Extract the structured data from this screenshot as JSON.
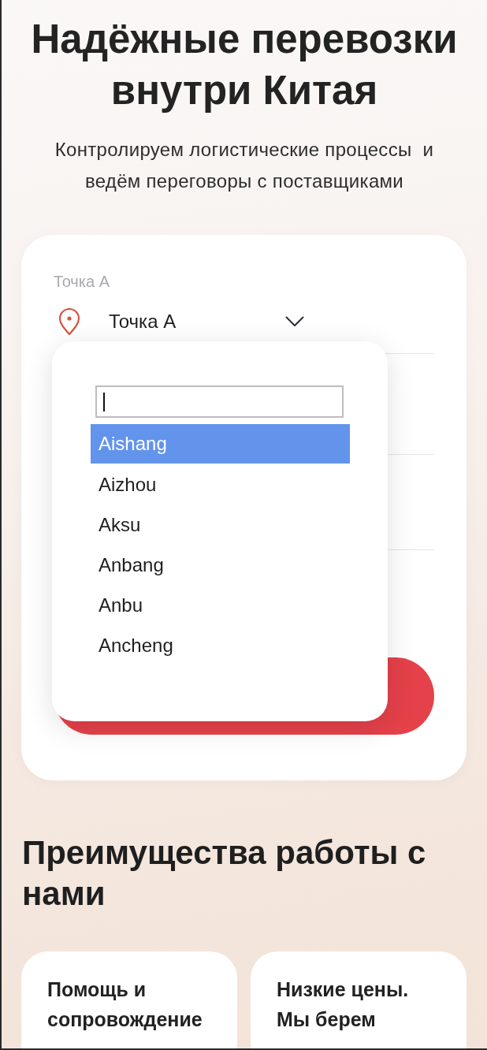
{
  "hero": {
    "title": "Надёжные перевозки внутри Китая",
    "subtitle": "Контролируем логистические процессы  и ведём переговоры с поставщиками"
  },
  "route_form": {
    "field": {
      "label": "Точка А",
      "value": "Точка А",
      "expanded": true
    },
    "dropdown": {
      "search": {
        "focused": true
      },
      "options": [
        {
          "label": "Aishang",
          "selected": true
        },
        {
          "label": "Aizhou",
          "selected": false
        },
        {
          "label": "Aksu",
          "selected": false
        },
        {
          "label": "Anbang",
          "selected": false
        },
        {
          "label": "Anbu",
          "selected": false
        },
        {
          "label": "Ancheng",
          "selected": false
        }
      ]
    }
  },
  "advantages": {
    "title": "Преимущества работы с нами",
    "cards": [
      {
        "text": "Помощь и сопровождение"
      },
      {
        "text": "Низкие цены. Мы берем"
      }
    ]
  }
}
